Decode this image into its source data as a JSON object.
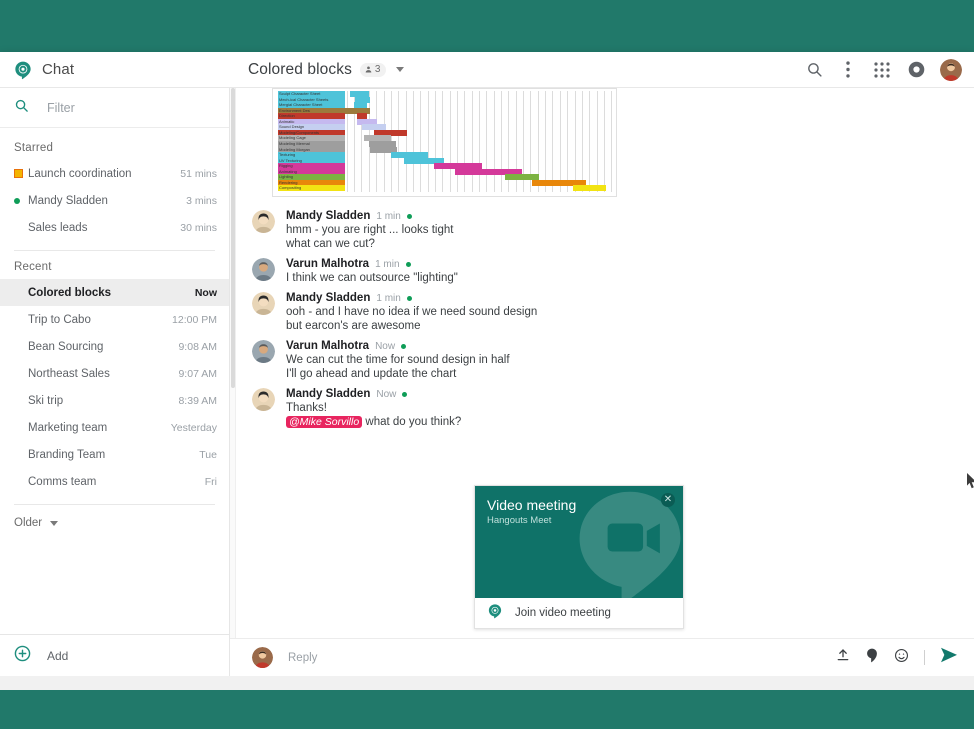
{
  "brand": {
    "title": "Chat",
    "logo_icon": "hangouts-chat-logo-icon"
  },
  "topbar": {
    "conversation_title": "Colored blocks",
    "member_count": "3",
    "members_icon": "person-icon",
    "dropdown_icon": "chevron-down-icon",
    "actions": [
      {
        "name": "search-icon",
        "label": "Search"
      },
      {
        "name": "more-options-icon",
        "label": "More options"
      },
      {
        "name": "apps-grid-icon",
        "label": "Google apps"
      },
      {
        "name": "account-status-icon",
        "label": "Account"
      }
    ],
    "avatar_name": "user-avatar"
  },
  "sidebar": {
    "filter": {
      "placeholder": "Filter",
      "value": "",
      "icon": "search-icon"
    },
    "sections": [
      {
        "label": "Starred",
        "items": [
          {
            "name": "Launch coordination",
            "time": "51 mins",
            "mark": "square-orange",
            "active": false
          },
          {
            "name": "Mandy Sladden",
            "time": "3 mins",
            "mark": "dot-green",
            "active": false
          },
          {
            "name": "Sales leads",
            "time": "30 mins",
            "mark": "none",
            "active": false
          }
        ]
      },
      {
        "label": "Recent",
        "items": [
          {
            "name": "Colored blocks",
            "time": "Now",
            "mark": "none",
            "active": true
          },
          {
            "name": "Trip to Cabo",
            "time": "12:00 PM",
            "mark": "none",
            "active": false
          },
          {
            "name": "Bean Sourcing",
            "time": "9:08 AM",
            "mark": "none",
            "active": false
          },
          {
            "name": "Northeast Sales",
            "time": "9:07 AM",
            "mark": "none",
            "active": false
          },
          {
            "name": "Ski trip",
            "time": "8:39 AM",
            "mark": "none",
            "active": false
          },
          {
            "name": "Marketing team",
            "time": "Yesterday",
            "mark": "none",
            "active": false
          },
          {
            "name": "Branding Team",
            "time": "Tue",
            "mark": "none",
            "active": false
          },
          {
            "name": "Comms team",
            "time": "Fri",
            "mark": "none",
            "active": false
          }
        ]
      }
    ],
    "older_label": "Older",
    "older_icon": "chevron-down-icon",
    "add_label": "Add",
    "add_icon": "plus-circle-icon"
  },
  "attachment": {
    "kind": "gantt-chart-image",
    "rows": [
      {
        "label": "Sculpt Character Sheet",
        "color": "#4ec3d9",
        "bar_color": "#4ec3d9",
        "start": 22.0,
        "width": 5.5
      },
      {
        "label": "Mech-ical Character Sheets",
        "color": "#4ec3d9",
        "bar_color": "#4ec3d9",
        "start": 23.5,
        "width": 4.5
      },
      {
        "label": "Mergial Character Sheet",
        "color": "#4ec3d9",
        "bar_color": "#4ec3d9",
        "start": 23.0,
        "width": 4.0
      },
      {
        "label": "Environment Design",
        "color": "#9c7a3c",
        "bar_color": "#9c7a3c",
        "start": 10.0,
        "width": 18.0
      },
      {
        "label": "Direction",
        "color": "#c0392b",
        "bar_color": "#c0392b",
        "start": 24.0,
        "width": 3.0
      },
      {
        "label": "Animatic",
        "color": "#c5b9ef",
        "bar_color": "#c5b9ef",
        "start": 24.0,
        "width": 6.0
      },
      {
        "label": "Sound Design",
        "color": "#c5cff0",
        "bar_color": "#c5cff0",
        "start": 25.5,
        "width": 7.0
      },
      {
        "label": "Modeling/Components",
        "color": "#c0392b",
        "bar_color": "#c0392b",
        "start": 29.0,
        "width": 10.0
      },
      {
        "label": "Modeling Cage",
        "color": "#b3b3b3",
        "bar_color": "#b3b3b3",
        "start": 26.0,
        "width": 8.0
      },
      {
        "label": "Modeling Mermal",
        "color": "#9e9e9e",
        "bar_color": "#9e9e9e",
        "start": 27.5,
        "width": 8.0
      },
      {
        "label": "Modeling Morgan",
        "color": "#9e9e9e",
        "bar_color": "#9e9e9e",
        "start": 28.0,
        "width": 8.0
      },
      {
        "label": "Texturing",
        "color": "#4ec3d9",
        "bar_color": "#4ec3d9",
        "start": 34.0,
        "width": 11.0
      },
      {
        "label": "UV Texturing",
        "color": "#4ec3d9",
        "bar_color": "#4ec3d9",
        "start": 38.0,
        "width": 12.0
      },
      {
        "label": "Rigging",
        "color": "#d4399a",
        "bar_color": "#d4399a",
        "start": 47.0,
        "width": 14.0
      },
      {
        "label": "Animating",
        "color": "#d4399a",
        "bar_color": "#d4399a",
        "start": 53.0,
        "width": 20.0
      },
      {
        "label": "Lighting",
        "color": "#7cb342",
        "bar_color": "#7cb342",
        "start": 68.0,
        "width": 10.0
      },
      {
        "label": "Rendering",
        "color": "#e8870a",
        "bar_color": "#e8870a",
        "start": 76.0,
        "width": 16.0
      },
      {
        "label": "Compositing",
        "color": "#f2e313",
        "bar_color": "#f2e313",
        "start": 88.0,
        "width": 10.0
      }
    ]
  },
  "messages": [
    {
      "author": "Mandy Sladden",
      "time": "1 min",
      "unread": true,
      "avatar": "avatar-mandy",
      "lines": [
        "hmm - you are right ... looks tight",
        "what can we cut?"
      ]
    },
    {
      "author": "Varun Malhotra",
      "time": "1 min",
      "unread": true,
      "avatar": "avatar-varun",
      "lines": [
        "I think we can outsource \"lighting\""
      ]
    },
    {
      "author": "Mandy Sladden",
      "time": "1 min",
      "unread": true,
      "avatar": "avatar-mandy",
      "lines": [
        "ooh - and I have no idea if we need sound design",
        "but earcon's are awesome"
      ]
    },
    {
      "author": "Varun Malhotra",
      "time": "Now",
      "unread": true,
      "avatar": "avatar-varun",
      "lines": [
        "We can cut the time for sound design in half",
        "I'll go ahead and update the chart"
      ]
    },
    {
      "author": "Mandy Sladden",
      "time": "Now",
      "unread": true,
      "avatar": "avatar-mandy",
      "lines": [
        "Thanks!"
      ],
      "mention": "@Mike Sorvillo",
      "mention_tail": " what do you think?"
    }
  ],
  "reply": {
    "placeholder": "Reply",
    "value": "",
    "avatar": "reply-avatar",
    "actions": [
      {
        "name": "upload-icon",
        "label": "Upload file"
      },
      {
        "name": "drive-icon",
        "label": "Add from Drive"
      },
      {
        "name": "emoji-icon",
        "label": "Insert emoji"
      },
      {
        "name": "send-icon",
        "label": "Send"
      }
    ]
  },
  "meet_card": {
    "title": "Video meeting",
    "subtitle": "Hangouts Meet",
    "close_icon": "close-icon",
    "join_label": "Join video meeting",
    "join_icon": "hangouts-chat-logo-icon",
    "hero_color": "#0f7268"
  },
  "colors": {
    "page_background": "#21796a",
    "accent_teal": "#0f7268",
    "presence_green": "#0f9d58",
    "mention_pink": "#e8255f",
    "active_row": "#ededed"
  }
}
